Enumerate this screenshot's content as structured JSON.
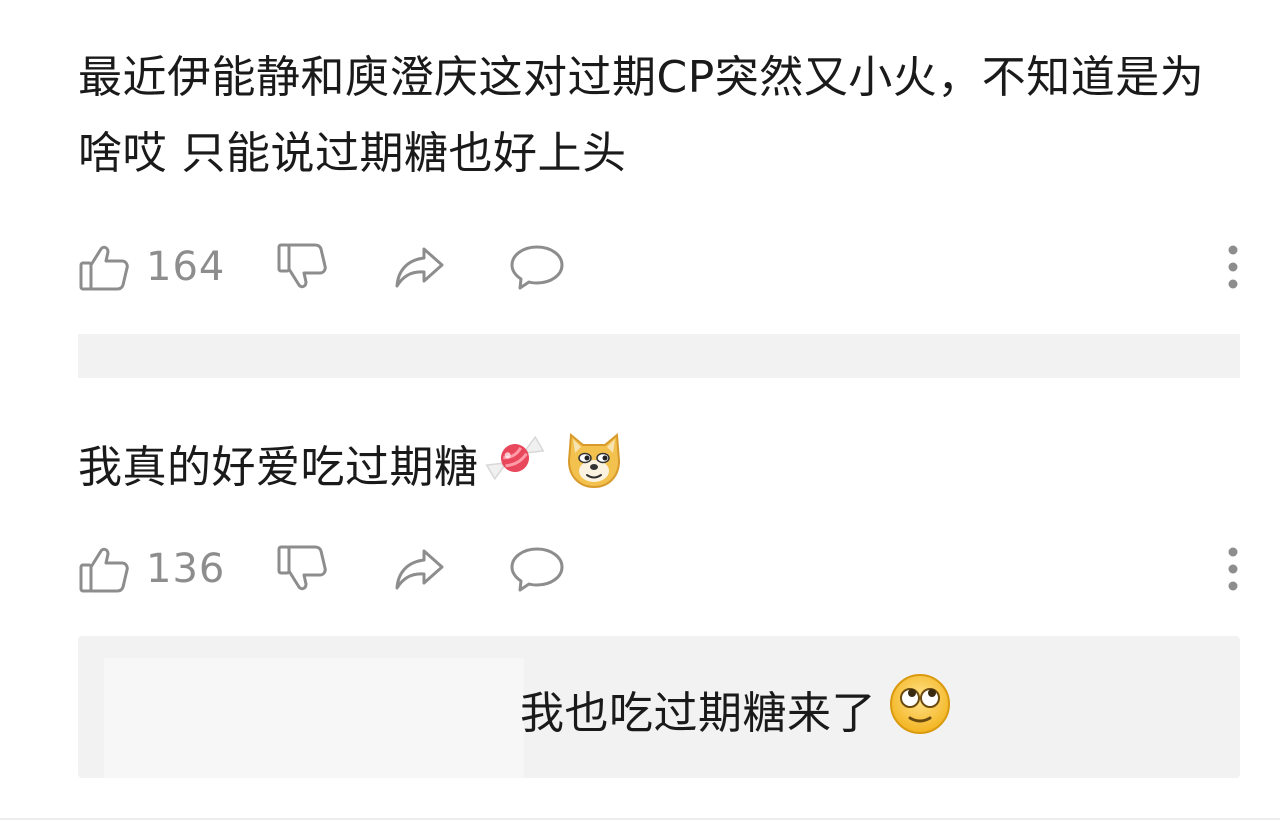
{
  "comments": [
    {
      "text": "最近伊能静和庾澄庆这对过期CP突然又小火，不知道是为啥哎 只能说过期糖也好上头",
      "likes": "164"
    },
    {
      "text": "我真的好爱吃过期糖",
      "emojis": [
        "candy",
        "doge"
      ],
      "likes": "136",
      "reply": {
        "text": "我也吃过期糖来了",
        "emoji": "rolling-eyes"
      }
    }
  ],
  "icons": {
    "like": "thumbs-up-icon",
    "dislike": "thumbs-down-icon",
    "share": "share-arrow-icon",
    "comment": "speech-bubble-icon",
    "more": "more-vertical-icon"
  },
  "colors": {
    "text": "#1a1a1a",
    "icon_gray": "#8d8d8d",
    "panel_bg": "#f2f2f2"
  }
}
